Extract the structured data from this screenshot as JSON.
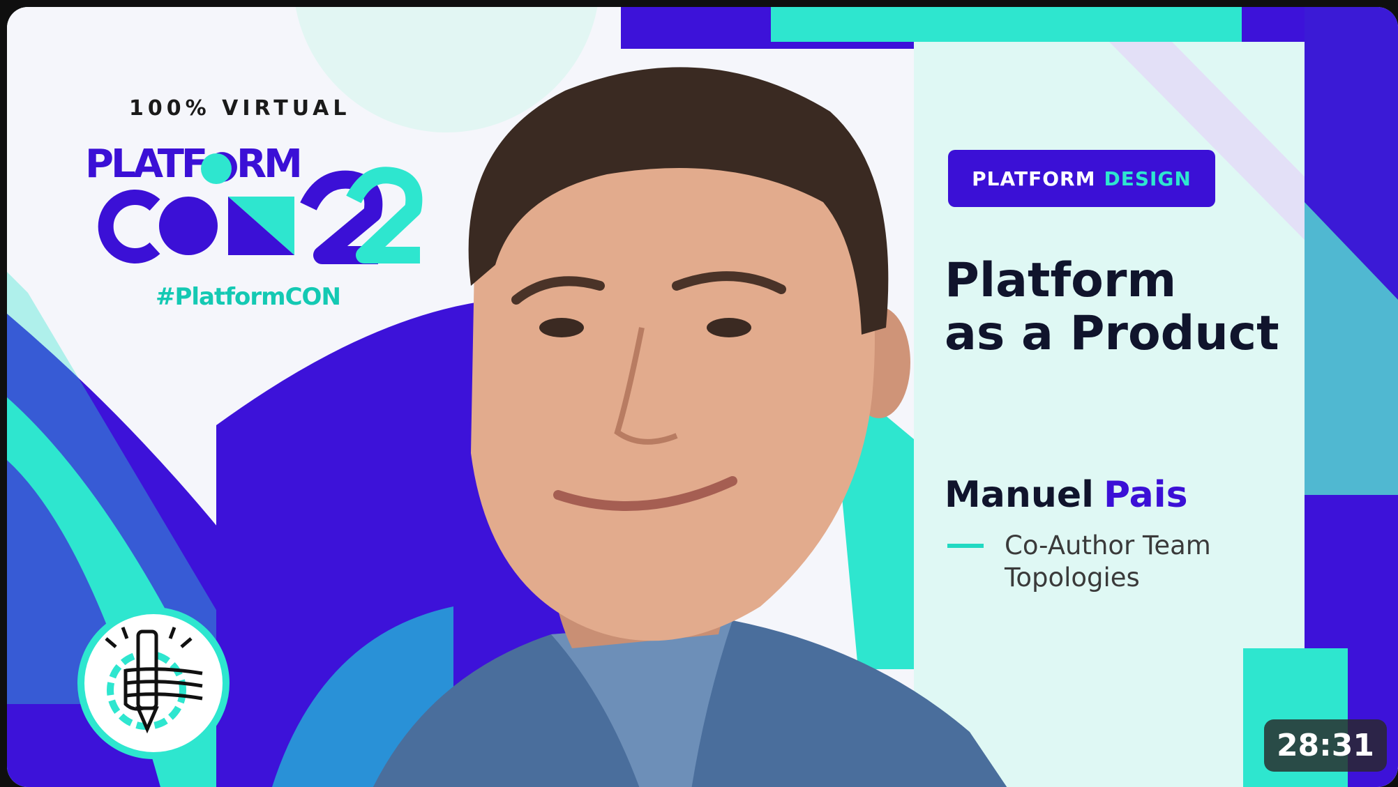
{
  "event": {
    "eyebrow": "100% VIRTUAL",
    "logo_line1": "PLATF●RM",
    "logo_line2": "CON",
    "logo_year": "22",
    "hashtag": "#PlatformCON"
  },
  "talk": {
    "track_primary": "PLATFORM",
    "track_accent": "DESIGN",
    "title_line1": "Platform",
    "title_line2": "as a Product"
  },
  "speaker": {
    "first_name": "Manuel",
    "last_name": "Pais",
    "role_line1": "Co-Author Team",
    "role_line2": "Topologies"
  },
  "video": {
    "duration": "28:31"
  },
  "colors": {
    "brand_purple": "#3b10d6",
    "brand_teal": "#21d9c2",
    "dark_text": "#10142c"
  },
  "icons": {
    "badge": "hand-holding-pencil-gear-icon"
  }
}
